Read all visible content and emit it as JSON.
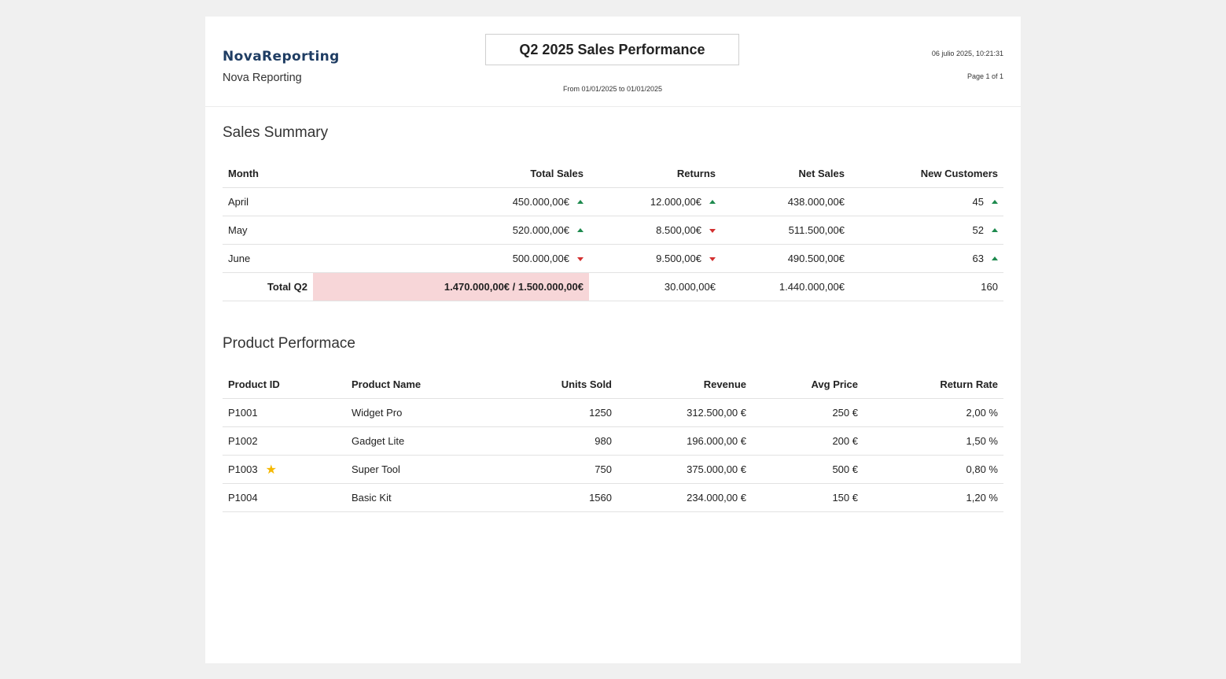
{
  "header": {
    "logo_text": "NovaReporting",
    "company_name": "Nova Reporting",
    "report_title": "Q2 2025 Sales Performance",
    "date_range": "From 01/01/2025 to 01/01/2025",
    "timestamp": "06 julio 2025, 10:21:31",
    "page_label": "Page 1 of 1"
  },
  "colors": {
    "trend_up": "#1e8a4e",
    "trend_down": "#d32f2f",
    "highlight": "#f7d6d8",
    "star": "#f5b800"
  },
  "sales_summary": {
    "title": "Sales Summary",
    "columns": [
      "Month",
      "Total Sales",
      "Returns",
      "Net Sales",
      "New Customers"
    ],
    "rows": [
      {
        "month": "April",
        "total_sales": "450.000,00€",
        "total_sales_trend": "up",
        "returns": "12.000,00€",
        "returns_trend": "up",
        "net_sales": "438.000,00€",
        "new_customers": "45",
        "new_customers_trend": "up"
      },
      {
        "month": "May",
        "total_sales": "520.000,00€",
        "total_sales_trend": "up",
        "returns": "8.500,00€",
        "returns_trend": "down",
        "net_sales": "511.500,00€",
        "new_customers": "52",
        "new_customers_trend": "up"
      },
      {
        "month": "June",
        "total_sales": "500.000,00€",
        "total_sales_trend": "down",
        "returns": "9.500,00€",
        "returns_trend": "down",
        "net_sales": "490.500,00€",
        "new_customers": "63",
        "new_customers_trend": "up"
      }
    ],
    "total": {
      "label": "Total Q2",
      "total_sales": "1.470.000,00€ / 1.500.000,00€",
      "returns": "30.000,00€",
      "net_sales": "1.440.000,00€",
      "new_customers": "160"
    }
  },
  "product_performance": {
    "title": "Product Performace",
    "columns": [
      "Product ID",
      "Product Name",
      "Units Sold",
      "Revenue",
      "Avg Price",
      "Return Rate"
    ],
    "rows": [
      {
        "id": "P1001",
        "name": "Widget Pro",
        "units": "1250",
        "revenue": "312.500,00 €",
        "avg_price": "250 €",
        "return_rate": "2,00 %",
        "starred": false
      },
      {
        "id": "P1002",
        "name": "Gadget Lite",
        "units": "980",
        "revenue": "196.000,00 €",
        "avg_price": "200 €",
        "return_rate": "1,50 %",
        "starred": false
      },
      {
        "id": "P1003",
        "name": "Super Tool",
        "units": "750",
        "revenue": "375.000,00 €",
        "avg_price": "500 €",
        "return_rate": "0,80 %",
        "starred": true,
        "star_icon": "star-icon"
      },
      {
        "id": "P1004",
        "name": "Basic Kit",
        "units": "1560",
        "revenue": "234.000,00 €",
        "avg_price": "150 €",
        "return_rate": "1,20 %",
        "starred": false
      }
    ]
  }
}
